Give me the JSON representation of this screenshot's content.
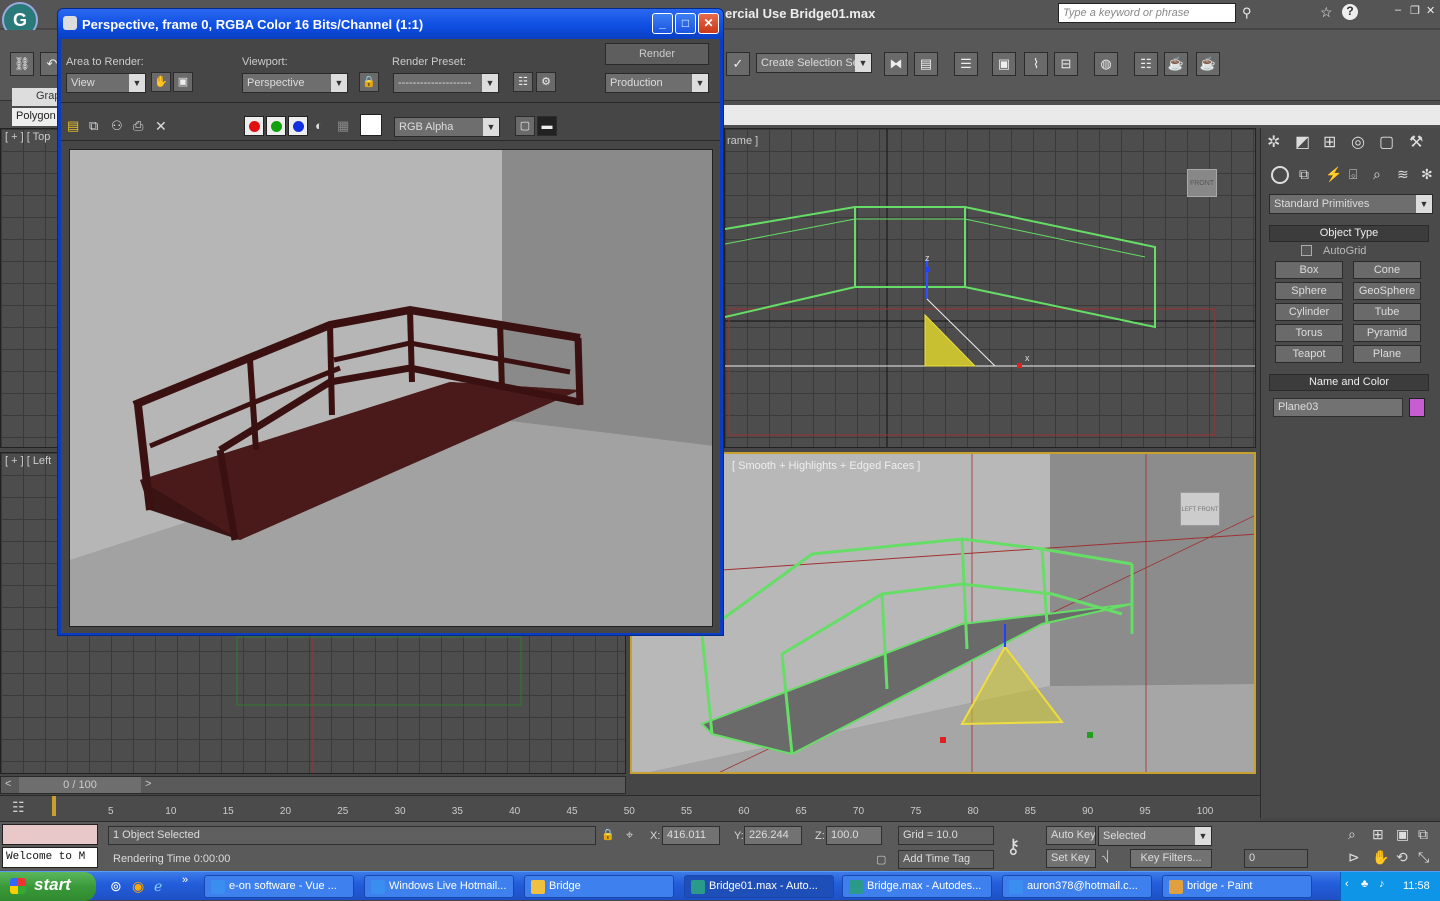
{
  "main_title": "ercial Use    Bridge01.max",
  "search_placeholder": "Type a keyword or phrase",
  "selection_set": "Create Selection Se",
  "graphite_tab": "Grap",
  "polygon_tab": "Polygon",
  "viewports": {
    "top_label": "[ + ] [ Top",
    "front_label": "rame ]",
    "left_label": "[ + ] [ Left",
    "persp_label": "[ Smooth + Highlights + Edged Faces ]",
    "viewcube_front": "FRONT",
    "viewcube_left": "LEFT",
    "viewcube_front2": "FRONT"
  },
  "command_panel": {
    "category": "Standard Primitives",
    "object_type_title": "Object Type",
    "autogrid": "AutoGrid",
    "buttons": [
      "Box",
      "Cone",
      "Sphere",
      "GeoSphere",
      "Cylinder",
      "Tube",
      "Torus",
      "Pyramid",
      "Teapot",
      "Plane"
    ],
    "name_color_title": "Name and Color",
    "object_name": "Plane03",
    "object_color": "#c65dd0"
  },
  "timeline": {
    "frame_label": "0 / 100",
    "ticks": [
      "5",
      "10",
      "15",
      "20",
      "25",
      "30",
      "35",
      "40",
      "45",
      "50",
      "55",
      "60",
      "65",
      "70",
      "75",
      "80",
      "85",
      "90",
      "95",
      "100"
    ]
  },
  "status": {
    "selected_text": "1 Object Selected",
    "render_time": "Rendering Time  0:00:00",
    "script_text": "Welcome to M",
    "x_label": "X:",
    "x_value": "416.011",
    "y_label": "Y:",
    "y_value": "226.244",
    "z_label": "Z:",
    "z_value": "100.0",
    "grid_text": "Grid = 10.0",
    "add_time_tag": "Add Time Tag",
    "auto_key": "Auto Key",
    "selected_dd": "Selected",
    "set_key": "Set Key",
    "key_filters": "Key Filters...",
    "frame_field": "0"
  },
  "render_window": {
    "title": "Perspective, frame 0, RGBA Color 16 Bits/Channel (1:1)",
    "area_label": "Area to Render:",
    "area_value": "View",
    "viewport_label": "Viewport:",
    "viewport_value": "Perspective",
    "preset_label": "Render Preset:",
    "preset_value": "--------------------",
    "render_button": "Render",
    "production_value": "Production",
    "channel_value": "RGB Alpha"
  },
  "taskbar": {
    "start": "start",
    "tasks": [
      {
        "label": "e-on software - Vue ...",
        "color": "#3a8ef0"
      },
      {
        "label": "Windows Live Hotmail...",
        "color": "#3a8ef0"
      },
      {
        "label": "Bridge",
        "color": "#f0c040"
      },
      {
        "label": "Bridge01.max - Auto...",
        "color": "#2a9a8a"
      },
      {
        "label": "Bridge.max - Autodes...",
        "color": "#2a9a8a"
      },
      {
        "label": "auron378@hotmail.c...",
        "color": "#3a8ef0"
      },
      {
        "label": "bridge - Paint",
        "color": "#e0a040"
      }
    ],
    "clock": "11:58"
  }
}
